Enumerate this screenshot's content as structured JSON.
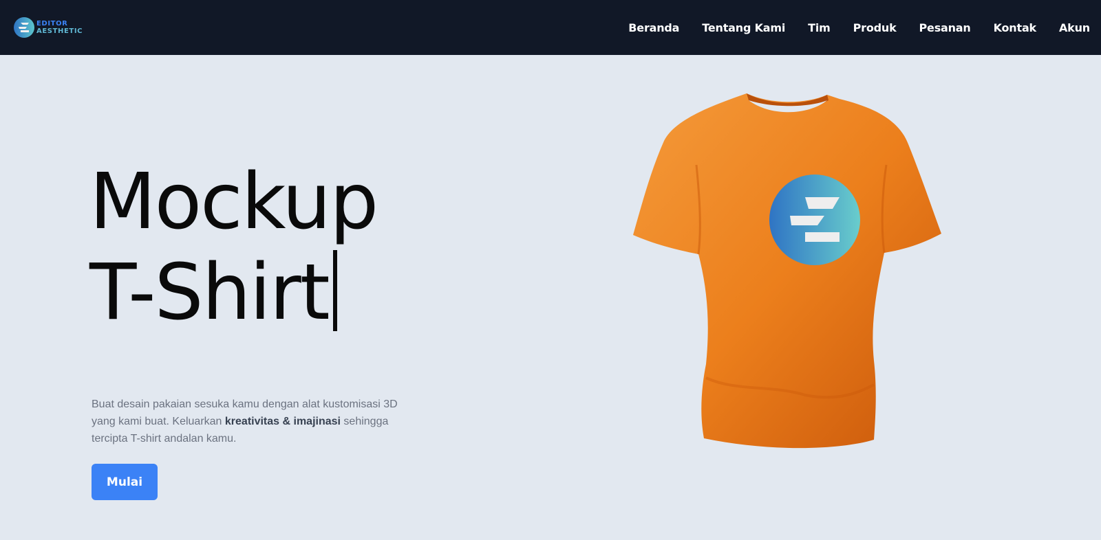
{
  "brand": {
    "line1": "EDITOR",
    "line2": "AESTHETIC",
    "icon": "editor-aesthetic-logo"
  },
  "nav": {
    "items": [
      {
        "label": "Beranda"
      },
      {
        "label": "Tentang Kami"
      },
      {
        "label": "Tim"
      },
      {
        "label": "Produk"
      },
      {
        "label": "Pesanan"
      },
      {
        "label": "Kontak"
      },
      {
        "label": "Akun"
      }
    ]
  },
  "hero": {
    "title_line1": "Mockup",
    "title_line2": "T-Shirt",
    "description_part1": "Buat desain pakaian sesuka kamu dengan alat kustomisasi 3D yang kami buat. Keluarkan ",
    "description_bold": "kreativitas & imajinasi",
    "description_part2": " sehingga tercipta T-shirt andalan kamu.",
    "cta_label": "Mulai"
  },
  "colors": {
    "navbar_bg": "#111827",
    "page_bg": "#e2e8f0",
    "accent": "#3b82f6",
    "shirt": "#ec7f1c"
  }
}
